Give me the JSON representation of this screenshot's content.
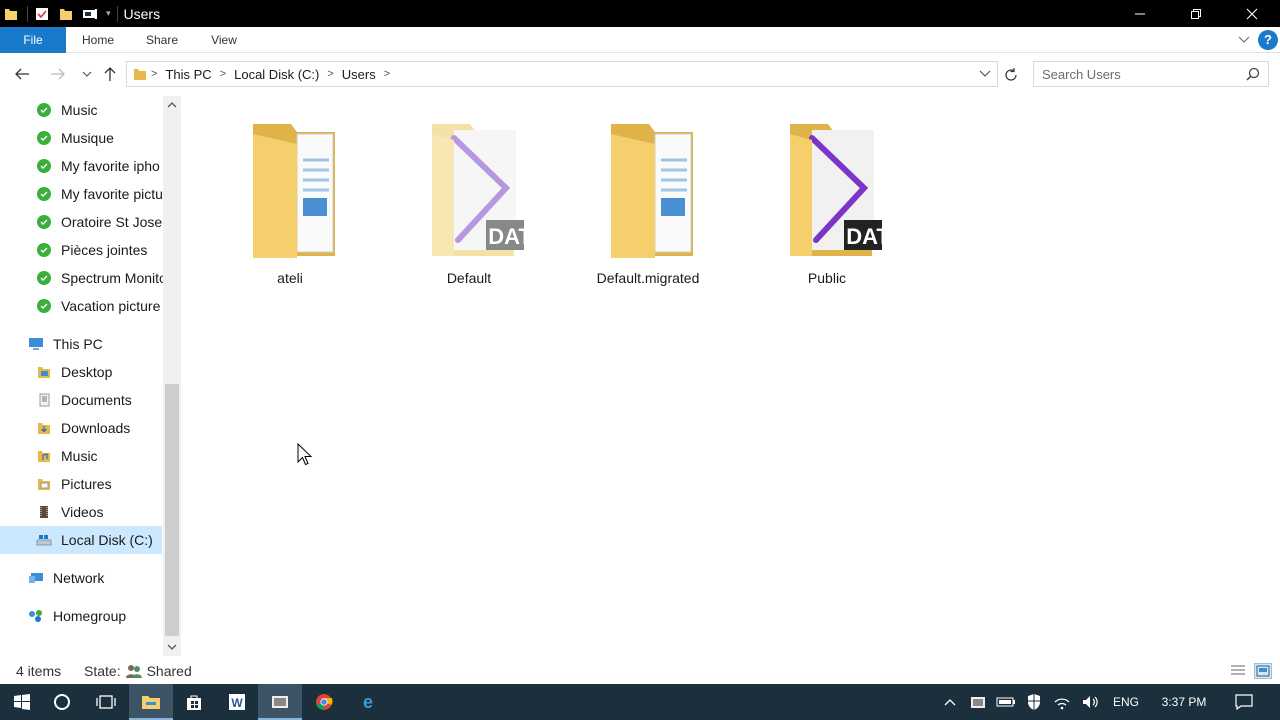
{
  "window": {
    "title": "Users"
  },
  "ribbon": {
    "tabs": [
      "File",
      "Home",
      "Share",
      "View"
    ],
    "help_label": "?"
  },
  "address": {
    "crumbs": [
      "This PC",
      "Local Disk (C:)",
      "Users"
    ]
  },
  "search": {
    "placeholder": "Search Users"
  },
  "navpane": {
    "quick_items": [
      "Music",
      "Musique",
      "My favorite ipho",
      "My favorite pictu",
      "Oratoire St Josep",
      "Pièces jointes",
      "Spectrum Monito",
      "Vacation picture"
    ],
    "this_pc": "This PC",
    "pc_items": [
      {
        "label": "Desktop",
        "icon": "desktop-folder-icon"
      },
      {
        "label": "Documents",
        "icon": "documents-folder-icon"
      },
      {
        "label": "Downloads",
        "icon": "downloads-folder-icon"
      },
      {
        "label": "Music",
        "icon": "music-folder-icon"
      },
      {
        "label": "Pictures",
        "icon": "pictures-folder-icon"
      },
      {
        "label": "Videos",
        "icon": "videos-folder-icon"
      },
      {
        "label": "Local Disk (C:)",
        "icon": "local-disk-icon",
        "selected": true
      }
    ],
    "network": "Network",
    "homegroup": "Homegroup"
  },
  "files": [
    {
      "name": "ateli",
      "icon": "folder-documents-icon"
    },
    {
      "name": "Default",
      "icon": "folder-dat-faded-icon"
    },
    {
      "name": "Default.migrated",
      "icon": "folder-documents-icon"
    },
    {
      "name": "Public",
      "icon": "folder-dat-icon"
    }
  ],
  "status": {
    "count": "4 items",
    "state_label": "State:",
    "state_value": "Shared"
  },
  "taskbar": {
    "language": "ENG",
    "time": "3:37 PM"
  },
  "colors": {
    "accent": "#1979ca",
    "selected_bg": "#cce8ff",
    "taskbar": "#1b2f3d",
    "folder_yellow": "#f5cf6b"
  }
}
